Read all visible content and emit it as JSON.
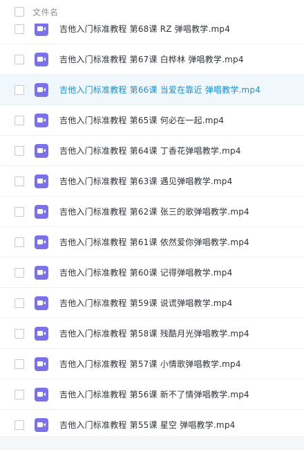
{
  "header": {
    "column_label": "文件名"
  },
  "colors": {
    "file_icon": "#7b72e9",
    "selected_text": "#1a90d4",
    "selected_row_bg": "#f0f7fd"
  },
  "icons": {
    "file_type": "video-file-icon",
    "row_select": "checkbox-icon"
  },
  "files": [
    {
      "name": "吉他入门标准教程 第68课 RZ 弹唱教学.mp4"
    },
    {
      "name": "吉他入门标准教程 第67课 白桦林 弹唱教学.mp4"
    },
    {
      "name": "吉他入门标准教程 第66课 当爱在靠近 弹唱教学.mp4",
      "selected": true
    },
    {
      "name": "吉他入门标准教程 第65课 何必在一起.mp4"
    },
    {
      "name": "吉他入门标准教程 第64课 丁香花弹唱教学.mp4"
    },
    {
      "name": "吉他入门标准教程 第63课 遇见弹唱教学.mp4"
    },
    {
      "name": "吉他入门标准教程 第62课 张三的歌弹唱教学.mp4"
    },
    {
      "name": "吉他入门标准教程 第61课 依然爱你弹唱教学.mp4"
    },
    {
      "name": "吉他入门标准教程 第60课 记得弹唱教学.mp4"
    },
    {
      "name": "吉他入门标准教程 第59课 说谎弹唱教学.mp4"
    },
    {
      "name": "吉他入门标准教程 第58课 残酷月光弹唱教学.mp4"
    },
    {
      "name": "吉他入门标准教程 第57课 小情歌弹唱教学.mp4"
    },
    {
      "name": "吉他入门标准教程 第56课 新不了情弹唱教学.mp4"
    },
    {
      "name": "吉他入门标准教程 第55课 星空 弹唱教学.mp4"
    }
  ]
}
